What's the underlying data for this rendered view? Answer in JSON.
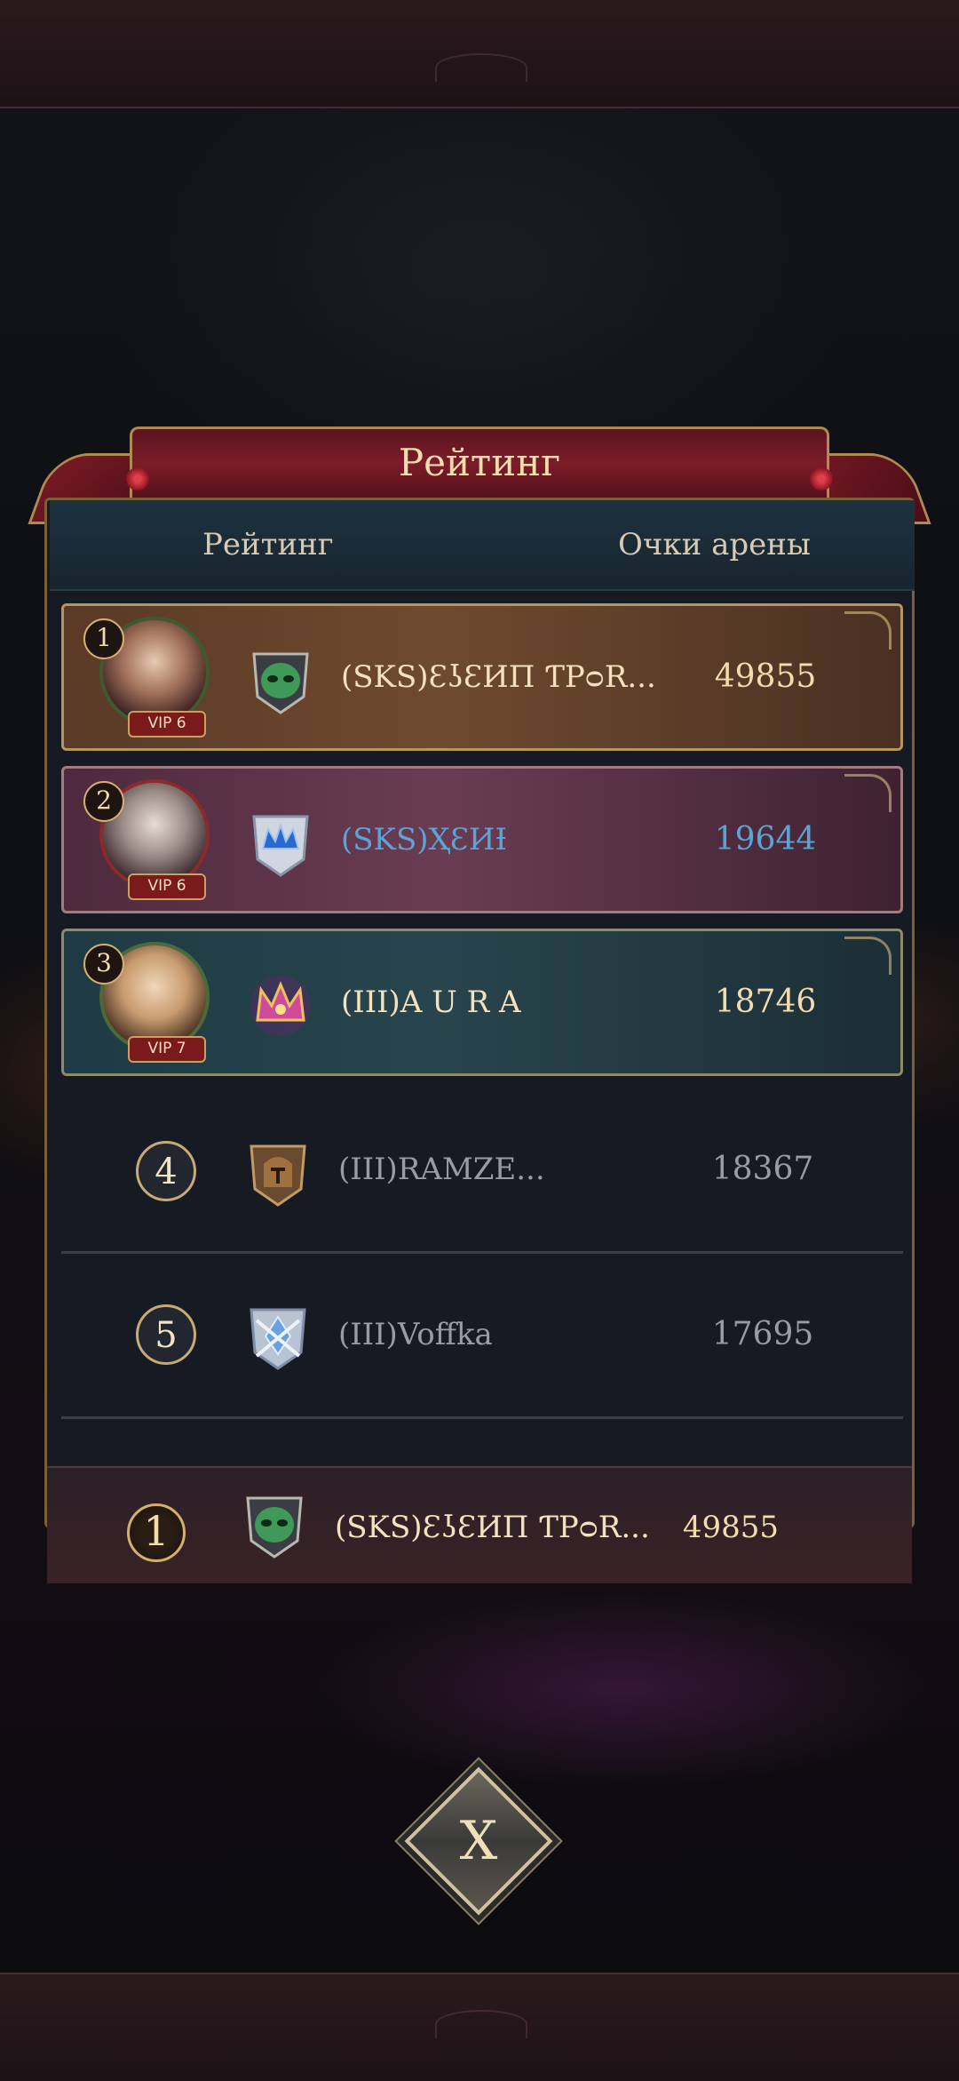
{
  "panel": {
    "title": "Рейтинг",
    "headers": {
      "rank": "Рейтинг",
      "points": "Очки арены"
    }
  },
  "rows": [
    {
      "rank": "1",
      "vip": "VIP 6",
      "name": "(SKS)ƐʖƐИП ƬРᴑR...",
      "score": "49855",
      "style": "top1",
      "emblem": "green-mask"
    },
    {
      "rank": "2",
      "vip": "VIP 6",
      "name": "(SKS)ҲƐИƗ",
      "score": "19644",
      "style": "top2",
      "emblem": "blue-crown"
    },
    {
      "rank": "3",
      "vip": "VIP 7",
      "name": "(III)A U R A",
      "score": "18746",
      "style": "top3",
      "emblem": "pink-crown"
    },
    {
      "rank": "4",
      "name": "(III)RAMZE...",
      "score": "18367",
      "style": "plain",
      "emblem": "bronze-helmet"
    },
    {
      "rank": "5",
      "name": "(III)Voffka",
      "score": "17695",
      "style": "plain",
      "emblem": "silver-crossed"
    }
  ],
  "self": {
    "rank": "1",
    "name": "(SKS)ƐʖƐИП ƬРᴑR...",
    "score": "49855",
    "emblem": "green-mask"
  },
  "close": {
    "label": "X"
  },
  "colors": {
    "gold_text": "#f3dcae",
    "blue_text": "#5aa4d6",
    "gray_text": "#9a9ca4",
    "frame_gold": "#b08a50",
    "banner_red": "#7c1c28"
  }
}
